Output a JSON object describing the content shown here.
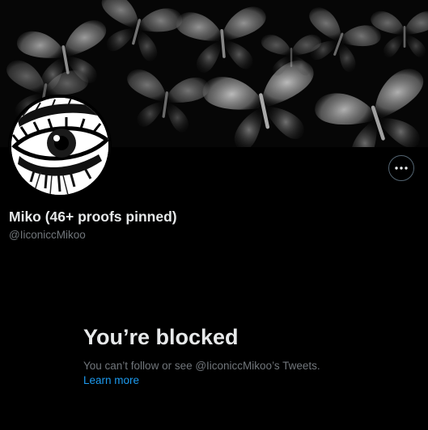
{
  "profile": {
    "display_name": "Miko (46+ proofs pinned)",
    "handle": "@IiconiccMikoo"
  },
  "blocked": {
    "title": "You’re blocked",
    "message": "You can’t follow or see @IiconiccMikoo’s Tweets.",
    "learn_more": "Learn more"
  },
  "icons": {
    "more": "more-horizontal-icon"
  },
  "colors": {
    "background": "#000000",
    "primary_text": "#e7e9ea",
    "secondary_text": "#71767b",
    "link": "#1d9bf0",
    "border": "#536471"
  }
}
